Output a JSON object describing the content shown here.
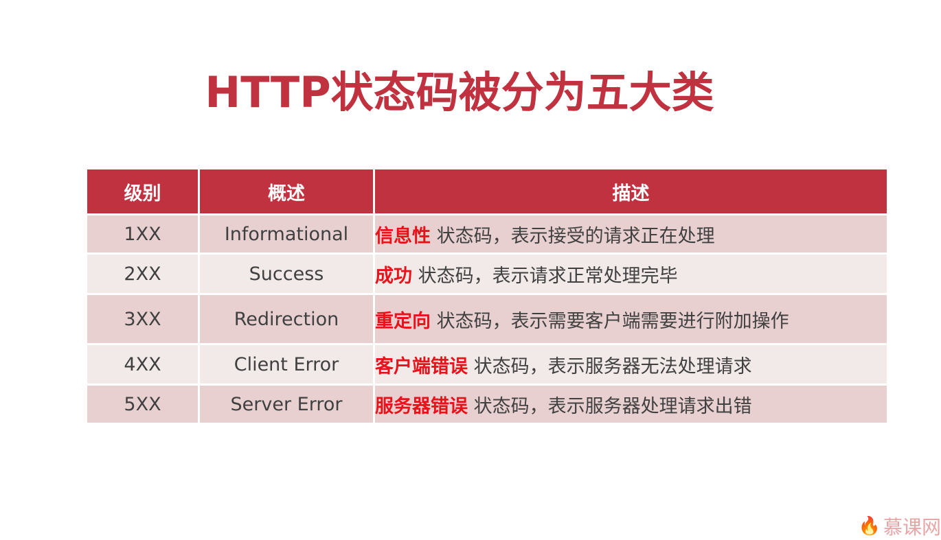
{
  "title": "HTTP状态码被分为五大类",
  "table": {
    "headers": [
      "级别",
      "概述",
      "描述"
    ],
    "rows": [
      {
        "level": "1XX",
        "summary": "Informational",
        "highlight": "信息性",
        "desc": " 状态码，表示接受的请求正在处理"
      },
      {
        "level": "2XX",
        "summary": "Success",
        "highlight": "成功",
        "desc": " 状态码，表示请求正常处理完毕"
      },
      {
        "level": "3XX",
        "summary": "Redirection",
        "highlight": "重定向",
        "desc": " 状态码，表示需要客户端需要进行附加操作"
      },
      {
        "level": "4XX",
        "summary": "Client Error",
        "highlight": "客户端错误",
        "desc": " 状态码，表示服务器无法处理请求"
      },
      {
        "level": "5XX",
        "summary": "Server Error",
        "highlight": "服务器错误",
        "desc": " 状态码，表示服务器处理请求出错"
      }
    ]
  },
  "watermark": {
    "icon": "flame-icon",
    "text": "慕课网"
  },
  "colors": {
    "accent": "#c0323f",
    "highlight": "#e8121b",
    "row_odd": "#e8d0d1",
    "row_even": "#f2e9e9"
  }
}
